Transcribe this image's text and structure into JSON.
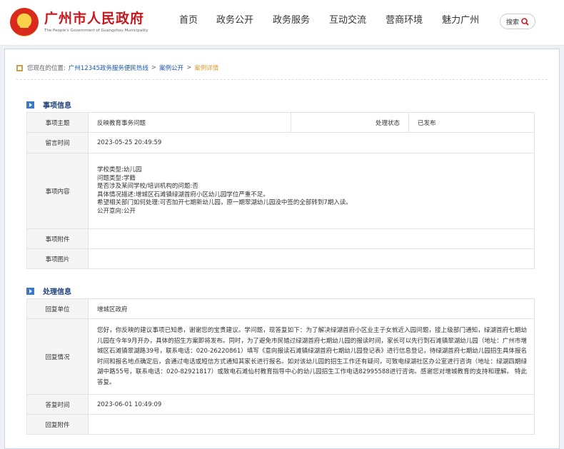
{
  "header": {
    "title": "广州市人民政府",
    "subtitle": "The People's Government of Guangzhou Municipality",
    "nav": [
      "首页",
      "政务公开",
      "政务服务",
      "互动交流",
      "营商环境",
      "魅力广州"
    ],
    "search_label": "搜索"
  },
  "breadcrumb": {
    "prefix": "您现在的位置:",
    "items": [
      "广州12345政务服务便民热线",
      "案例公开",
      "案例详情"
    ],
    "separator": ">"
  },
  "matter": {
    "section_title": "事项信息",
    "subject_label": "事项主题",
    "subject_value": "反映教育事务问题",
    "status_label": "处理状态",
    "status_value": "已发布",
    "time_label": "留言时间",
    "time_value": "2023-05-25 20:49:59",
    "content_label": "事项内容",
    "content_lines": [
      "学校类型:幼儿园",
      "问题类型:学籍",
      "是否涉及某间学校/培训机构的问题:否",
      "具体情况描述:增城区石滩镇绿湖首府小区幼儿园学位严重不足。",
      "希望相关部门如何处理:可否加开七期新幼儿园，原一期翠湖幼儿园没中签的全部转到7期入读。",
      "公开意向:公开"
    ],
    "attachment_label": "事项附件",
    "image_label": "事项图片"
  },
  "handling": {
    "section_title": "处理信息",
    "unit_label": "回复单位",
    "unit_value": "增城区政府",
    "reply_label": "回复情况",
    "reply_text": "您好，你反映的建议事项已知悉，谢谢您的宝贵建议。学问题，现答复如下：为了解决绿湖首府小区业主子女就近入园问题，接上级部门通知，绿湖首府七期幼儿园在今年9月开办，具体的招生方案即将发布。同时，为了避免市民错过绿湖首府七期幼儿园的报读时间，家长可以先行到石滩镇翠湖幼儿园（地址：广州市增城区石滩镇翠湖路39号，联系电话：020-26220861）填写《意向报读石滩镇绿湖首府七期幼儿园登记表》进行信息登记，待绿湖首府七期幼儿园招生具体报名时间和报名地点确定后，会通过电话或短信方式通知其家长进行报名。如对该幼儿园的招生工作还有疑问，可致电绿湖社区办公室进行咨询（地址：绿湖四期绿湖中路55号，联系电话：020-82921817）或致电石滩仙村教育指导中心的幼儿园招生工作电话82995588进行咨询。感谢您对增城教育的支持和理解。 特此答复。",
    "reply_time_label": "答复时间",
    "reply_time_value": "2023-06-01 10:49:09",
    "reply_attachment_label": "回复附件"
  },
  "colors": {
    "brand_red": "#c8161d",
    "link_blue": "#1a56b0",
    "status_red": "#d9221a",
    "section_blue": "#1c3f78"
  }
}
